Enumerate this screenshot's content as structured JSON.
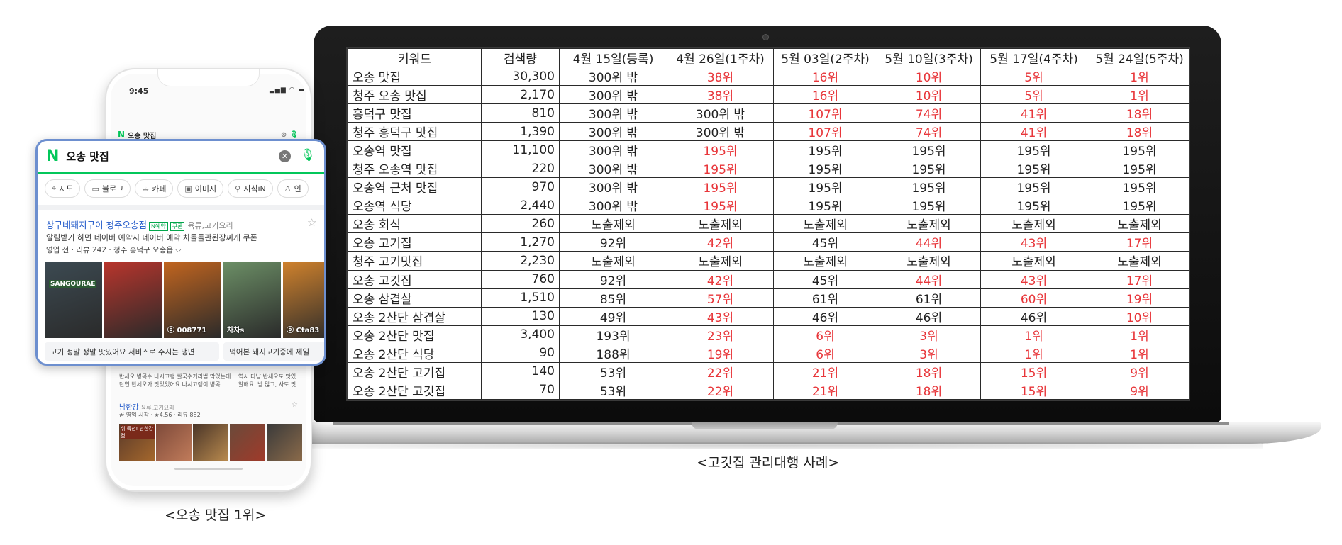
{
  "laptop_table": {
    "headers": [
      "키워드",
      "검색량",
      "4월 15일(등록)",
      "4월 26일(1주차)",
      "5월 03일(2주차)",
      "5월 10일(3주차)",
      "5월 17일(4주차)",
      "5월 24일(5주차)"
    ],
    "rows": [
      {
        "keyword": "오송 맛집",
        "volume": "30,300",
        "ranks": [
          "300위 밖",
          "38위",
          "16위",
          "10위",
          "5위",
          "1위"
        ],
        "red": [
          false,
          true,
          true,
          true,
          true,
          true
        ]
      },
      {
        "keyword": "청주 오송 맛집",
        "volume": "2,170",
        "ranks": [
          "300위 밖",
          "38위",
          "16위",
          "10위",
          "5위",
          "1위"
        ],
        "red": [
          false,
          true,
          true,
          true,
          true,
          true
        ]
      },
      {
        "keyword": "흥덕구 맛집",
        "volume": "810",
        "ranks": [
          "300위 밖",
          "300위 밖",
          "107위",
          "74위",
          "41위",
          "18위"
        ],
        "red": [
          false,
          false,
          true,
          true,
          true,
          true
        ]
      },
      {
        "keyword": "청주 흥덕구 맛집",
        "volume": "1,390",
        "ranks": [
          "300위 밖",
          "300위 밖",
          "107위",
          "74위",
          "41위",
          "18위"
        ],
        "red": [
          false,
          false,
          true,
          true,
          true,
          true
        ]
      },
      {
        "keyword": "오송역 맛집",
        "volume": "11,100",
        "ranks": [
          "300위 밖",
          "195위",
          "195위",
          "195위",
          "195위",
          "195위"
        ],
        "red": [
          false,
          true,
          false,
          false,
          false,
          false
        ]
      },
      {
        "keyword": "청주 오송역 맛집",
        "volume": "220",
        "ranks": [
          "300위 밖",
          "195위",
          "195위",
          "195위",
          "195위",
          "195위"
        ],
        "red": [
          false,
          true,
          false,
          false,
          false,
          false
        ]
      },
      {
        "keyword": "오송역 근처 맛집",
        "volume": "970",
        "ranks": [
          "300위 밖",
          "195위",
          "195위",
          "195위",
          "195위",
          "195위"
        ],
        "red": [
          false,
          true,
          false,
          false,
          false,
          false
        ]
      },
      {
        "keyword": "오송역 식당",
        "volume": "2,440",
        "ranks": [
          "300위 밖",
          "195위",
          "195위",
          "195위",
          "195위",
          "195위"
        ],
        "red": [
          false,
          true,
          false,
          false,
          false,
          false
        ]
      },
      {
        "keyword": "오송 회식",
        "volume": "260",
        "ranks": [
          "노출제외",
          "노출제외",
          "노출제외",
          "노출제외",
          "노출제외",
          "노출제외"
        ],
        "red": [
          false,
          false,
          false,
          false,
          false,
          false
        ]
      },
      {
        "keyword": "오송 고기집",
        "volume": "1,270",
        "ranks": [
          "92위",
          "42위",
          "45위",
          "44위",
          "43위",
          "17위"
        ],
        "red": [
          false,
          true,
          false,
          true,
          true,
          true
        ]
      },
      {
        "keyword": "청주 고기맛집",
        "volume": "2,230",
        "ranks": [
          "노출제외",
          "노출제외",
          "노출제외",
          "노출제외",
          "노출제외",
          "노출제외"
        ],
        "red": [
          false,
          false,
          false,
          false,
          false,
          false
        ]
      },
      {
        "keyword": "오송 고깃집",
        "volume": "760",
        "ranks": [
          "92위",
          "42위",
          "45위",
          "44위",
          "43위",
          "17위"
        ],
        "red": [
          false,
          true,
          false,
          true,
          true,
          true
        ]
      },
      {
        "keyword": "오송 삼겹살",
        "volume": "1,510",
        "ranks": [
          "85위",
          "57위",
          "61위",
          "61위",
          "60위",
          "19위"
        ],
        "red": [
          false,
          true,
          false,
          false,
          true,
          true
        ]
      },
      {
        "keyword": "오송 2산단 삼겹살",
        "volume": "130",
        "ranks": [
          "49위",
          "43위",
          "46위",
          "46위",
          "46위",
          "10위"
        ],
        "red": [
          false,
          true,
          false,
          false,
          false,
          true
        ]
      },
      {
        "keyword": "오송 2산단 맛집",
        "volume": "3,400",
        "ranks": [
          "193위",
          "23위",
          "6위",
          "3위",
          "1위",
          "1위"
        ],
        "red": [
          false,
          true,
          true,
          true,
          true,
          true
        ]
      },
      {
        "keyword": "오송 2산단 식당",
        "volume": "90",
        "ranks": [
          "188위",
          "19위",
          "6위",
          "3위",
          "1위",
          "1위"
        ],
        "red": [
          false,
          true,
          true,
          true,
          true,
          true
        ]
      },
      {
        "keyword": "오송 2산단 고기집",
        "volume": "140",
        "ranks": [
          "53위",
          "22위",
          "21위",
          "18위",
          "15위",
          "9위"
        ],
        "red": [
          false,
          true,
          true,
          true,
          true,
          true
        ]
      },
      {
        "keyword": "오송 2산단 고깃집",
        "volume": "70",
        "ranks": [
          "53위",
          "22위",
          "21위",
          "18위",
          "15위",
          "9위"
        ],
        "red": [
          false,
          true,
          true,
          true,
          true,
          true
        ]
      }
    ]
  },
  "phone": {
    "time": "9:45",
    "status_icons": "▂▄▆ ◠ ▬",
    "search_query": "오송 맛집",
    "logo": "N",
    "bg_row1": "반세오 병곡수 나시고랭 쌀국수커리법 막었는데",
    "bg_row2": "단연 반세오가 맛있었어요 나시고랭이 병곡..",
    "bg_row1b": "역시 다냥 반세오도 맛있",
    "bg_row2b": "알해요. 방 많고, 사도 맛",
    "second_place": "남한강",
    "second_place_cat": "육류,고기요리",
    "second_meta": "곧 영업 시작 · ★4.56 · 리뷰 882",
    "second_sign": "쉬 특선! 남한강 점"
  },
  "popup": {
    "logo": "N",
    "query": "오송 맛집",
    "chips": [
      {
        "icon": "map-pin-icon",
        "glyph": "⌖",
        "label": "지도"
      },
      {
        "icon": "blog-icon",
        "glyph": "▭",
        "label": "블로그"
      },
      {
        "icon": "cafe-icon",
        "glyph": "☕",
        "label": "카페"
      },
      {
        "icon": "image-icon",
        "glyph": "▣",
        "label": "이미지"
      },
      {
        "icon": "search-icon",
        "glyph": "⚲",
        "label": "지식iN"
      },
      {
        "icon": "person-icon",
        "glyph": "♙",
        "label": "인"
      }
    ],
    "place_name": "상구네돼지구이 청주오송점",
    "badge_reserve": "N예약",
    "badge_coupon": "쿠폰",
    "place_category": "육류,고기요리",
    "place_desc": "알림받기 하면 네이버 예약시 네이버 예약 차돌돌판된장찌개 쿠폰",
    "place_meta": "영업 전 · 리뷰 242 · 청주 흥덕구 오송읍 ⌵",
    "photo_sign": "SANGOURAE",
    "photo_tags": [
      "",
      "",
      "ⓞ 008771",
      "",
      "ⓞ Cta83"
    ],
    "photo_tag_4": "차차s",
    "photo_colors": [
      "#3c4a52",
      "#b9352c",
      "#c2651f",
      "#6c8f66",
      "#d0822d"
    ],
    "reviews": [
      "고기 정말 정말 맛있어요 서비스로 주시는 냉면",
      "먹어본 돼지고기중에 제일"
    ]
  },
  "captions": {
    "phone": "<오송 맛집 1위>",
    "laptop": "<고깃집 관리대행 사례>"
  }
}
